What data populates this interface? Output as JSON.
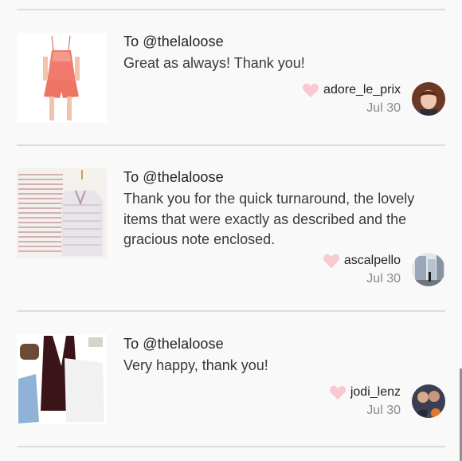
{
  "reviews": [
    {
      "to": "To @thelaloose",
      "message": "Great as always! Thank you!",
      "username": "adore_le_prix",
      "date": "Jul 30"
    },
    {
      "to": "To @thelaloose",
      "message": "Thank you for the quick turnaround, the lovely items that were exactly as described and the gracious note enclosed.",
      "username": "ascalpello",
      "date": "Jul 30"
    },
    {
      "to": "To @thelaloose",
      "message": "Very happy, thank you!",
      "username": "jodi_lenz",
      "date": "Jul 30"
    }
  ],
  "colors": {
    "heart": "#f8c9d0",
    "divider": "#dedede",
    "background": "#f9f9f9"
  }
}
